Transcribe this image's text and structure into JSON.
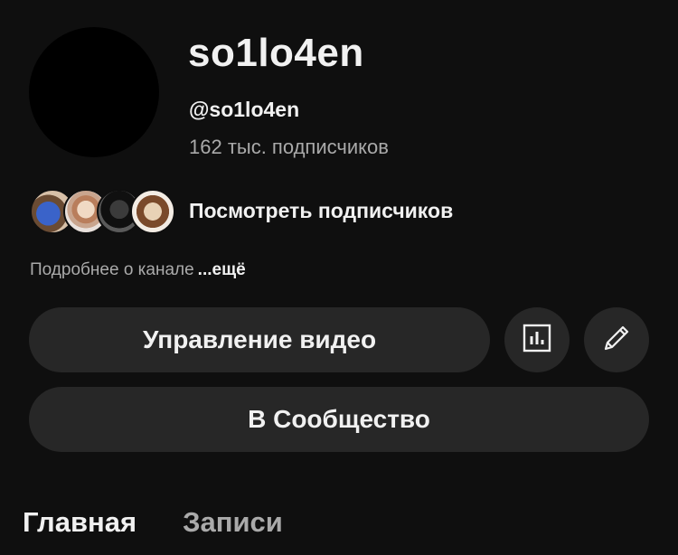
{
  "channel": {
    "name": "so1lo4en",
    "handle": "@so1lo4en",
    "subscribers": "162 тыс. подписчиков",
    "view_subscribers_label": "Посмотреть подписчиков",
    "about_text": "Подробнее о канале",
    "about_more": "...ещё"
  },
  "actions": {
    "manage_videos_label": "Управление видео",
    "stats_icon": "analytics-icon",
    "edit_icon": "pencil-icon",
    "community_label": "В Сообщество"
  },
  "tabs": [
    {
      "label": "Главная",
      "active": true
    },
    {
      "label": "Записи",
      "active": false
    }
  ],
  "colors": {
    "background": "#0f0f0f",
    "button_bg": "#272727",
    "text_primary": "#f1f1f1",
    "text_secondary": "#aaaaaa"
  }
}
